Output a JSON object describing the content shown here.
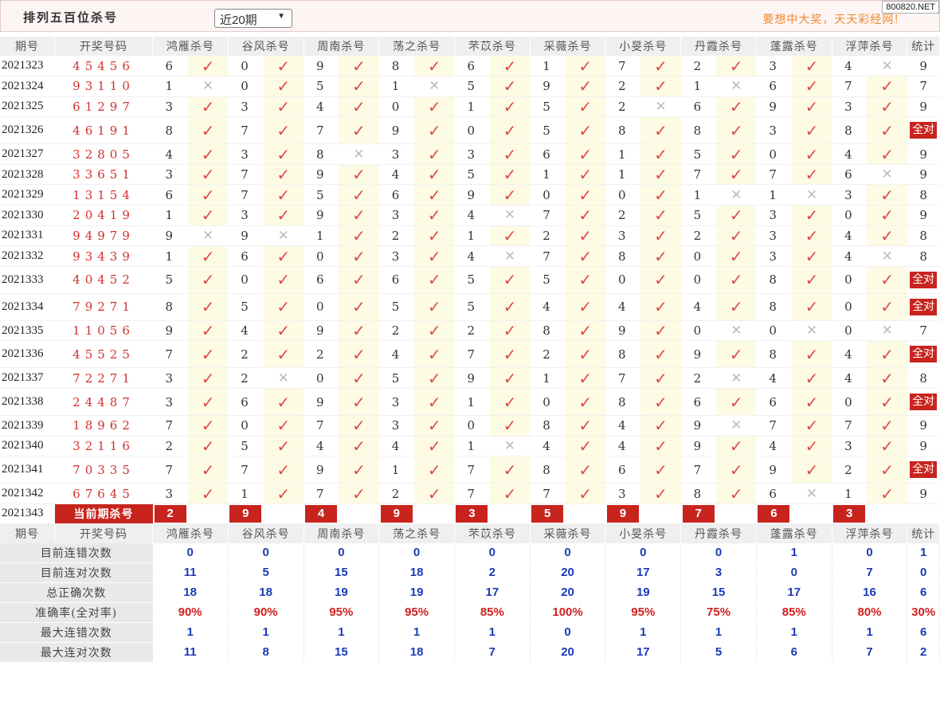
{
  "header": {
    "title": "排列五百位杀号",
    "select_value": "近20期",
    "slogan": "要想中大奖，天天彩经网!",
    "brand": "800820.NET"
  },
  "columns": {
    "period": "期号",
    "numbers": "开奖号码",
    "predictors": [
      "鸿雁杀号",
      "谷风杀号",
      "周南杀号",
      "荡之杀号",
      "芣苡杀号",
      "采薇杀号",
      "小旻杀号",
      "丹霞杀号",
      "蓬露杀号",
      "浮萍杀号"
    ],
    "stat": "统计"
  },
  "all_right_label": "全对",
  "rows": [
    {
      "period": "2021323",
      "numbers": "45456",
      "kills": [
        [
          6,
          1
        ],
        [
          0,
          1
        ],
        [
          9,
          1
        ],
        [
          8,
          1
        ],
        [
          6,
          1
        ],
        [
          1,
          1
        ],
        [
          7,
          1
        ],
        [
          2,
          1
        ],
        [
          3,
          1
        ],
        [
          4,
          0
        ]
      ],
      "stat": "9"
    },
    {
      "period": "2021324",
      "numbers": "93110",
      "kills": [
        [
          1,
          0
        ],
        [
          0,
          1
        ],
        [
          5,
          1
        ],
        [
          1,
          0
        ],
        [
          5,
          1
        ],
        [
          9,
          1
        ],
        [
          2,
          1
        ],
        [
          1,
          0
        ],
        [
          6,
          1
        ],
        [
          7,
          1
        ]
      ],
      "stat": "7"
    },
    {
      "period": "2021325",
      "numbers": "61297",
      "kills": [
        [
          3,
          1
        ],
        [
          3,
          1
        ],
        [
          4,
          1
        ],
        [
          0,
          1
        ],
        [
          1,
          1
        ],
        [
          5,
          1
        ],
        [
          2,
          0
        ],
        [
          6,
          1
        ],
        [
          9,
          1
        ],
        [
          3,
          1
        ]
      ],
      "stat": "9"
    },
    {
      "period": "2021326",
      "numbers": "46191",
      "kills": [
        [
          8,
          1
        ],
        [
          7,
          1
        ],
        [
          7,
          1
        ],
        [
          9,
          1
        ],
        [
          0,
          1
        ],
        [
          5,
          1
        ],
        [
          8,
          1
        ],
        [
          8,
          1
        ],
        [
          3,
          1
        ],
        [
          8,
          1
        ]
      ],
      "stat": "全对"
    },
    {
      "period": "2021327",
      "numbers": "32805",
      "kills": [
        [
          4,
          1
        ],
        [
          3,
          1
        ],
        [
          8,
          0
        ],
        [
          3,
          1
        ],
        [
          3,
          1
        ],
        [
          6,
          1
        ],
        [
          1,
          1
        ],
        [
          5,
          1
        ],
        [
          0,
          1
        ],
        [
          4,
          1
        ]
      ],
      "stat": "9"
    },
    {
      "period": "2021328",
      "numbers": "33651",
      "kills": [
        [
          3,
          1
        ],
        [
          7,
          1
        ],
        [
          9,
          1
        ],
        [
          4,
          1
        ],
        [
          5,
          1
        ],
        [
          1,
          1
        ],
        [
          1,
          1
        ],
        [
          7,
          1
        ],
        [
          7,
          1
        ],
        [
          6,
          0
        ]
      ],
      "stat": "9"
    },
    {
      "period": "2021329",
      "numbers": "13154",
      "kills": [
        [
          6,
          1
        ],
        [
          7,
          1
        ],
        [
          5,
          1
        ],
        [
          6,
          1
        ],
        [
          9,
          1
        ],
        [
          0,
          1
        ],
        [
          0,
          1
        ],
        [
          1,
          0
        ],
        [
          1,
          0
        ],
        [
          3,
          1
        ]
      ],
      "stat": "8"
    },
    {
      "period": "2021330",
      "numbers": "20419",
      "kills": [
        [
          1,
          1
        ],
        [
          3,
          1
        ],
        [
          9,
          1
        ],
        [
          3,
          1
        ],
        [
          4,
          0
        ],
        [
          7,
          1
        ],
        [
          2,
          1
        ],
        [
          5,
          1
        ],
        [
          3,
          1
        ],
        [
          0,
          1
        ]
      ],
      "stat": "9"
    },
    {
      "period": "2021331",
      "numbers": "94979",
      "kills": [
        [
          9,
          0
        ],
        [
          9,
          0
        ],
        [
          1,
          1
        ],
        [
          2,
          1
        ],
        [
          1,
          1
        ],
        [
          2,
          1
        ],
        [
          3,
          1
        ],
        [
          2,
          1
        ],
        [
          3,
          1
        ],
        [
          4,
          1
        ]
      ],
      "stat": "8"
    },
    {
      "period": "2021332",
      "numbers": "93439",
      "kills": [
        [
          1,
          1
        ],
        [
          6,
          1
        ],
        [
          0,
          1
        ],
        [
          3,
          1
        ],
        [
          4,
          0
        ],
        [
          7,
          1
        ],
        [
          8,
          1
        ],
        [
          0,
          1
        ],
        [
          3,
          1
        ],
        [
          4,
          0
        ]
      ],
      "stat": "8"
    },
    {
      "period": "2021333",
      "numbers": "40452",
      "kills": [
        [
          5,
          1
        ],
        [
          0,
          1
        ],
        [
          6,
          1
        ],
        [
          6,
          1
        ],
        [
          5,
          1
        ],
        [
          5,
          1
        ],
        [
          0,
          1
        ],
        [
          0,
          1
        ],
        [
          8,
          1
        ],
        [
          0,
          1
        ]
      ],
      "stat": "全对"
    },
    {
      "period": "2021334",
      "numbers": "79271",
      "kills": [
        [
          8,
          1
        ],
        [
          5,
          1
        ],
        [
          0,
          1
        ],
        [
          5,
          1
        ],
        [
          5,
          1
        ],
        [
          4,
          1
        ],
        [
          4,
          1
        ],
        [
          4,
          1
        ],
        [
          8,
          1
        ],
        [
          0,
          1
        ]
      ],
      "stat": "全对"
    },
    {
      "period": "2021335",
      "numbers": "11056",
      "kills": [
        [
          9,
          1
        ],
        [
          4,
          1
        ],
        [
          9,
          1
        ],
        [
          2,
          1
        ],
        [
          2,
          1
        ],
        [
          8,
          1
        ],
        [
          9,
          1
        ],
        [
          0,
          0
        ],
        [
          0,
          0
        ],
        [
          0,
          0
        ]
      ],
      "stat": "7"
    },
    {
      "period": "2021336",
      "numbers": "45525",
      "kills": [
        [
          7,
          1
        ],
        [
          2,
          1
        ],
        [
          2,
          1
        ],
        [
          4,
          1
        ],
        [
          7,
          1
        ],
        [
          2,
          1
        ],
        [
          8,
          1
        ],
        [
          9,
          1
        ],
        [
          8,
          1
        ],
        [
          4,
          1
        ]
      ],
      "stat": "全对"
    },
    {
      "period": "2021337",
      "numbers": "72271",
      "kills": [
        [
          3,
          1
        ],
        [
          2,
          0
        ],
        [
          0,
          1
        ],
        [
          5,
          1
        ],
        [
          9,
          1
        ],
        [
          1,
          1
        ],
        [
          7,
          1
        ],
        [
          2,
          0
        ],
        [
          4,
          1
        ],
        [
          4,
          1
        ]
      ],
      "stat": "8"
    },
    {
      "period": "2021338",
      "numbers": "24487",
      "kills": [
        [
          3,
          1
        ],
        [
          6,
          1
        ],
        [
          9,
          1
        ],
        [
          3,
          1
        ],
        [
          1,
          1
        ],
        [
          0,
          1
        ],
        [
          8,
          1
        ],
        [
          6,
          1
        ],
        [
          6,
          1
        ],
        [
          0,
          1
        ]
      ],
      "stat": "全对"
    },
    {
      "period": "2021339",
      "numbers": "18962",
      "kills": [
        [
          7,
          1
        ],
        [
          0,
          1
        ],
        [
          7,
          1
        ],
        [
          3,
          1
        ],
        [
          0,
          1
        ],
        [
          8,
          1
        ],
        [
          4,
          1
        ],
        [
          9,
          0
        ],
        [
          7,
          1
        ],
        [
          7,
          1
        ]
      ],
      "stat": "9"
    },
    {
      "period": "2021340",
      "numbers": "32116",
      "kills": [
        [
          2,
          1
        ],
        [
          5,
          1
        ],
        [
          4,
          1
        ],
        [
          4,
          1
        ],
        [
          1,
          0
        ],
        [
          4,
          1
        ],
        [
          4,
          1
        ],
        [
          9,
          1
        ],
        [
          4,
          1
        ],
        [
          3,
          1
        ]
      ],
      "stat": "9"
    },
    {
      "period": "2021341",
      "numbers": "70335",
      "kills": [
        [
          7,
          1
        ],
        [
          7,
          1
        ],
        [
          9,
          1
        ],
        [
          1,
          1
        ],
        [
          7,
          1
        ],
        [
          8,
          1
        ],
        [
          6,
          1
        ],
        [
          7,
          1
        ],
        [
          9,
          1
        ],
        [
          2,
          1
        ]
      ],
      "stat": "全对"
    },
    {
      "period": "2021342",
      "numbers": "67645",
      "kills": [
        [
          3,
          1
        ],
        [
          1,
          1
        ],
        [
          7,
          1
        ],
        [
          2,
          1
        ],
        [
          7,
          1
        ],
        [
          7,
          1
        ],
        [
          3,
          1
        ],
        [
          8,
          1
        ],
        [
          6,
          0
        ],
        [
          1,
          1
        ]
      ],
      "stat": "9"
    }
  ],
  "current": {
    "period": "2021343",
    "label": "当前期杀号",
    "kills": [
      "2",
      "9",
      "4",
      "9",
      "3",
      "5",
      "9",
      "7",
      "6",
      "3"
    ]
  },
  "summary": [
    {
      "label": "目前连错次数",
      "values": [
        "0",
        "0",
        "0",
        "0",
        "0",
        "0",
        "0",
        "0",
        "1",
        "0"
      ],
      "stat": "1",
      "color": "blue"
    },
    {
      "label": "目前连对次数",
      "values": [
        "11",
        "5",
        "15",
        "18",
        "2",
        "20",
        "17",
        "3",
        "0",
        "7"
      ],
      "stat": "0",
      "color": "blue"
    },
    {
      "label": "总正确次数",
      "values": [
        "18",
        "18",
        "19",
        "19",
        "17",
        "20",
        "19",
        "15",
        "17",
        "16"
      ],
      "stat": "6",
      "color": "blue"
    },
    {
      "label": "准确率(全对率)",
      "values": [
        "90%",
        "90%",
        "95%",
        "95%",
        "85%",
        "100%",
        "95%",
        "75%",
        "85%",
        "80%"
      ],
      "stat": "30%",
      "color": "red"
    },
    {
      "label": "最大连错次数",
      "values": [
        "1",
        "1",
        "1",
        "1",
        "1",
        "0",
        "1",
        "1",
        "1",
        "1"
      ],
      "stat": "6",
      "color": "blue"
    },
    {
      "label": "最大连对次数",
      "values": [
        "11",
        "8",
        "15",
        "18",
        "7",
        "20",
        "17",
        "5",
        "6",
        "7"
      ],
      "stat": "2",
      "color": "blue"
    }
  ],
  "colors": {
    "accent": "#c8241e",
    "number": "#d43030",
    "check": "#e04848",
    "summary_blue": "#1c39b8",
    "summary_red": "#d01f1f",
    "slogan": "#f08a2a"
  }
}
